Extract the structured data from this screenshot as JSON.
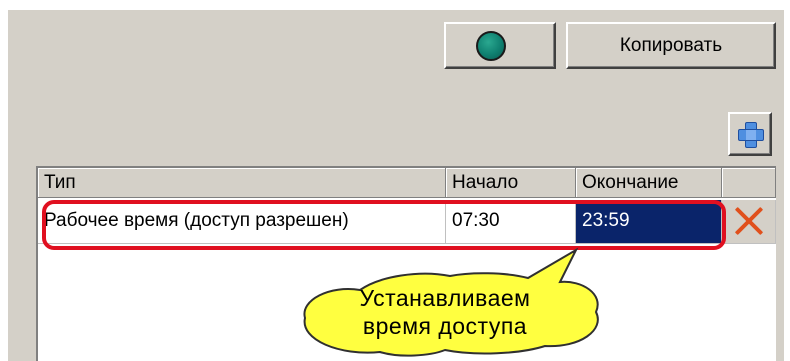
{
  "toolbar": {
    "copy_label": "Копировать"
  },
  "table": {
    "columns": [
      "Тип",
      "Начало",
      "Окончание"
    ],
    "rows": [
      {
        "type": "Рабочее время (доступ разрешен)",
        "start": "07:30",
        "end": "23:59"
      }
    ]
  },
  "callout": {
    "line1": "Устанавливаем",
    "line2": "время доступа"
  },
  "colors": {
    "panel": "#d4d0c8",
    "highlight": "#e01020",
    "selected_cell": "#0a246a",
    "callout_fill": "#ffff40",
    "status_led": "#0f8070",
    "delete_icon": "#e0501c"
  },
  "icons": {
    "status": "status-led-icon",
    "add": "add-plus-icon",
    "delete": "delete-x-icon"
  }
}
